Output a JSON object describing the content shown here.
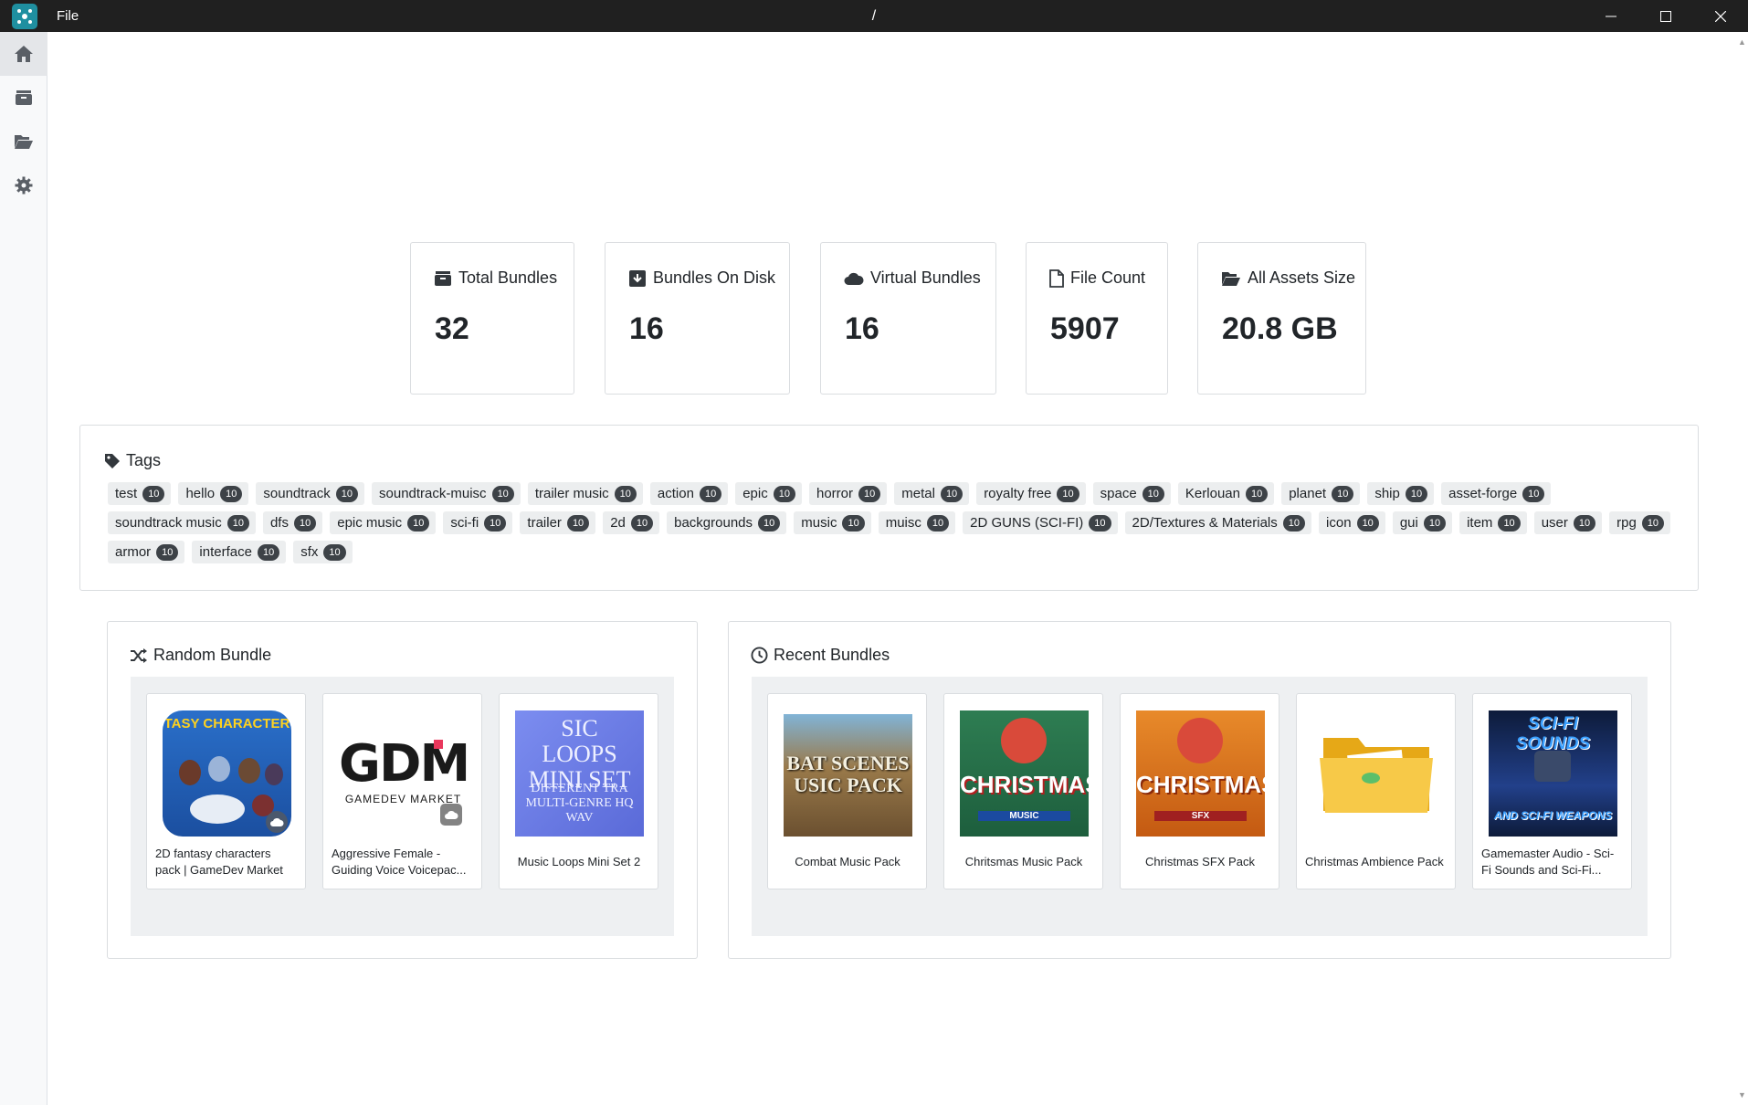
{
  "window": {
    "menu_label": "File",
    "path": "/"
  },
  "colors": {
    "titlebar": "#202020",
    "accent": "#1f8fa0",
    "badge": "#3d4247",
    "tag_bg": "#eceeef"
  },
  "sidebar": {
    "items": [
      {
        "icon": "home-icon"
      },
      {
        "icon": "archive-icon"
      },
      {
        "icon": "folder-open-icon"
      },
      {
        "icon": "gear-icon"
      }
    ]
  },
  "stats": [
    {
      "label": "Total Bundles",
      "value": "32",
      "icon": "archive-box-icon"
    },
    {
      "label": "Bundles On Disk",
      "value": "16",
      "icon": "download-box-icon"
    },
    {
      "label": "Virtual Bundles",
      "value": "16",
      "icon": "cloud-icon"
    },
    {
      "label": "File Count",
      "value": "5907",
      "icon": "file-icon"
    },
    {
      "label": "All Assets Size",
      "value": "20.8 GB",
      "icon": "folder-open-icon"
    }
  ],
  "tags": {
    "title": "Tags",
    "items": [
      {
        "name": "test",
        "count": "10"
      },
      {
        "name": "hello",
        "count": "10"
      },
      {
        "name": "soundtrack",
        "count": "10"
      },
      {
        "name": "soundtrack-muisc",
        "count": "10"
      },
      {
        "name": "trailer music",
        "count": "10"
      },
      {
        "name": "action",
        "count": "10"
      },
      {
        "name": "epic",
        "count": "10"
      },
      {
        "name": "horror",
        "count": "10"
      },
      {
        "name": "metal",
        "count": "10"
      },
      {
        "name": "royalty free",
        "count": "10"
      },
      {
        "name": "space",
        "count": "10"
      },
      {
        "name": "Kerlouan",
        "count": "10"
      },
      {
        "name": "planet",
        "count": "10"
      },
      {
        "name": "ship",
        "count": "10"
      },
      {
        "name": "asset-forge",
        "count": "10"
      },
      {
        "name": "soundtrack music",
        "count": "10"
      },
      {
        "name": "dfs",
        "count": "10"
      },
      {
        "name": "epic music",
        "count": "10"
      },
      {
        "name": "sci-fi",
        "count": "10"
      },
      {
        "name": "trailer",
        "count": "10"
      },
      {
        "name": "2d",
        "count": "10"
      },
      {
        "name": "backgrounds",
        "count": "10"
      },
      {
        "name": "music",
        "count": "10"
      },
      {
        "name": "muisc",
        "count": "10"
      },
      {
        "name": "2D GUNS (SCI-FI)",
        "count": "10"
      },
      {
        "name": "2D/Textures & Materials",
        "count": "10"
      },
      {
        "name": "icon",
        "count": "10"
      },
      {
        "name": "gui",
        "count": "10"
      },
      {
        "name": "item",
        "count": "10"
      },
      {
        "name": "user",
        "count": "10"
      },
      {
        "name": "rpg",
        "count": "10"
      },
      {
        "name": "armor",
        "count": "10"
      },
      {
        "name": "interface",
        "count": "10"
      },
      {
        "name": "sfx",
        "count": "10"
      }
    ]
  },
  "random_bundle": {
    "title": "Random Bundle",
    "items": [
      {
        "name": "2D fantasy characters pack | GameDev Market",
        "thumb_text": "TASY CHARACTER",
        "virtual": true
      },
      {
        "name": "Aggressive Female - Guiding Voice Voicepac...",
        "thumb_text": "GDM",
        "thumb_subtext": "GAMEDEV MARKET",
        "virtual": true
      },
      {
        "name": "Music Loops Mini Set 2",
        "thumb_text": "SIC LOOPS MINI SET",
        "thumb_subtext": "DIFFERENT TRA MULTI-GENRE HQ WAV",
        "virtual": false
      }
    ]
  },
  "recent_bundles": {
    "title": "Recent Bundles",
    "items": [
      {
        "name": "Combat Music Pack",
        "thumb_text": "BAT SCENES USIC PACK"
      },
      {
        "name": "Chritsmas Music Pack",
        "thumb_text": "CHRISTMAS",
        "thumb_subtext": "MUSIC"
      },
      {
        "name": "Christmas SFX Pack",
        "thumb_text": "CHRISTMAS",
        "thumb_subtext": "SFX"
      },
      {
        "name": "Christmas Ambience Pack",
        "thumb_text": ""
      },
      {
        "name": "Gamemaster Audio - Sci-Fi Sounds and Sci-Fi...",
        "thumb_text": "SCI-FI SOUNDS",
        "thumb_subtext": "AND SCI-FI WEAPONS"
      }
    ]
  }
}
